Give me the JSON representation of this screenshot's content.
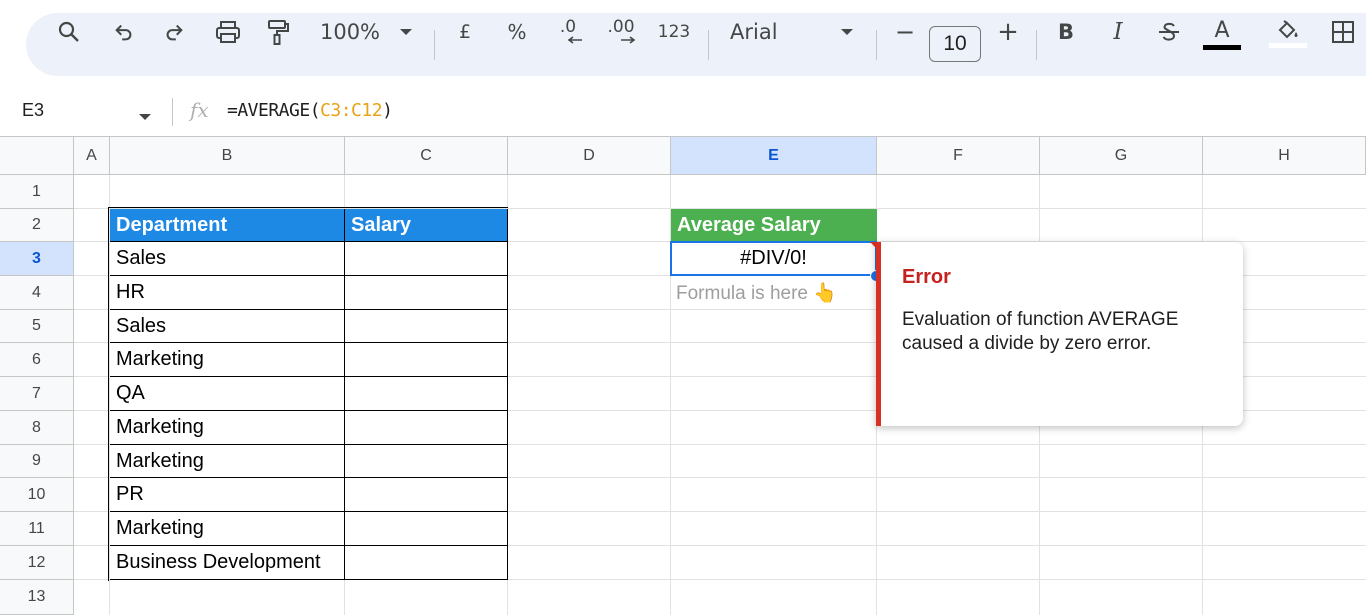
{
  "toolbar": {
    "zoom": "100%",
    "currency": "£",
    "percent": "%",
    "decrease_decimal": ".0",
    "increase_decimal": ".00",
    "number_format": "123",
    "font_family": "Arial",
    "font_size": "10",
    "minus": "−",
    "plus": "+",
    "bold": "B",
    "italic": "I",
    "text_color_label": "A",
    "text_color": "#000000",
    "icons": [
      "search-icon",
      "undo-icon",
      "redo-icon",
      "print-icon",
      "paint-format-icon",
      "fill-color-icon",
      "borders-icon"
    ]
  },
  "formula_bar": {
    "name_box": "E3",
    "fx": "fx",
    "formula_prefix": "=AVERAGE(",
    "formula_range": "C3:C12",
    "formula_suffix": ")"
  },
  "columns": [
    "A",
    "B",
    "C",
    "D",
    "E",
    "F",
    "G",
    "H"
  ],
  "rows": [
    "1",
    "2",
    "3",
    "4",
    "5",
    "6",
    "7",
    "8",
    "9",
    "10",
    "11",
    "12",
    "13"
  ],
  "table": {
    "headers": [
      "Department",
      "Salary"
    ],
    "departments": [
      "Sales",
      "HR",
      "Sales",
      "Marketing",
      "QA",
      "Marketing",
      "Marketing",
      "PR",
      "Marketing",
      "Business Development"
    ],
    "header_color": "#1e88e5"
  },
  "result": {
    "header": "Average Salary",
    "header_color": "#4caf50",
    "value": "#DIV/0!",
    "note": "Formula is here 👆"
  },
  "error_popup": {
    "title": "Error",
    "message": "Evaluation of function AVERAGE caused a divide by zero error.",
    "accent": "#d93025"
  }
}
